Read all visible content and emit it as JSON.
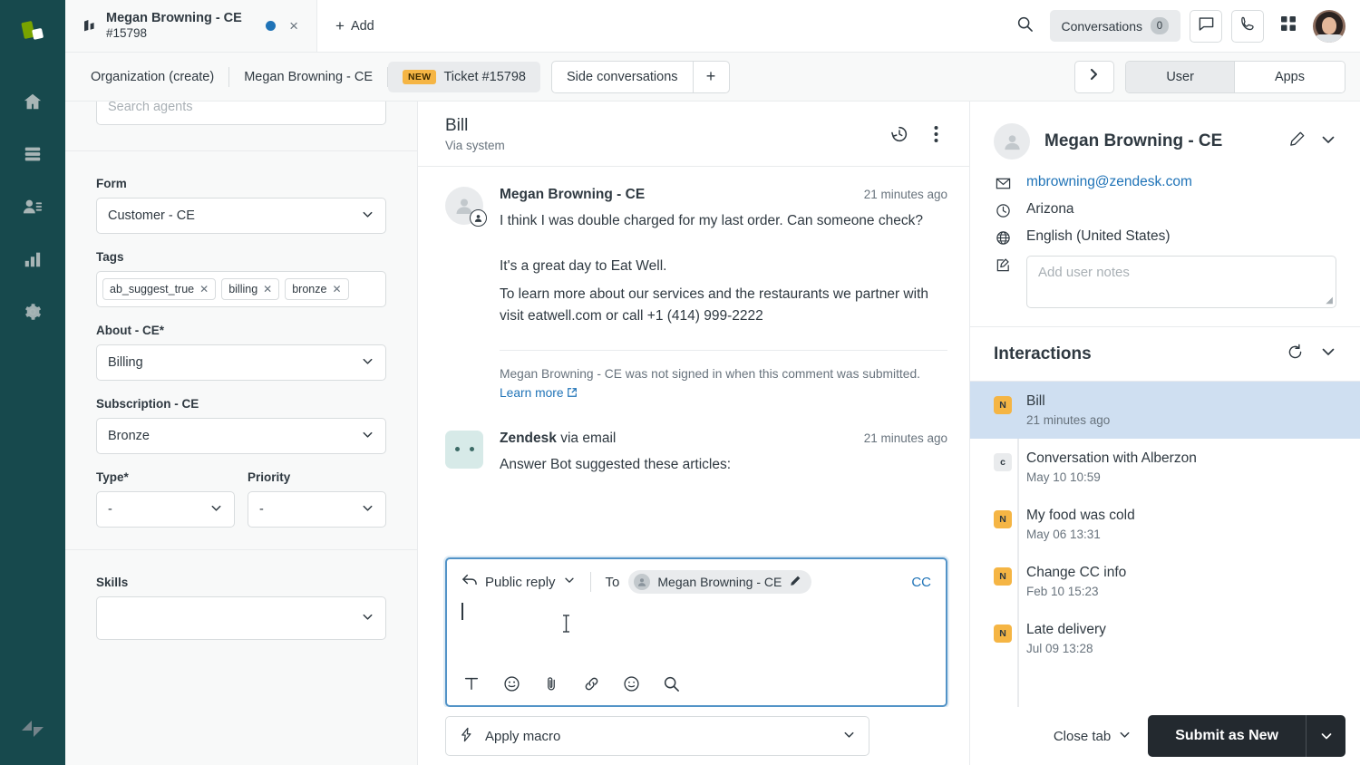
{
  "rail": {
    "logo_icon": "zendesk-mark-icon",
    "items": [
      {
        "icon": "home-icon",
        "name": "home"
      },
      {
        "icon": "views-icon",
        "name": "views"
      },
      {
        "icon": "customers-icon",
        "name": "customers"
      },
      {
        "icon": "reporting-icon",
        "name": "reporting"
      },
      {
        "icon": "settings-gear-icon",
        "name": "settings"
      }
    ],
    "bottom_icon": "zendesk-logo-icon"
  },
  "topbar": {
    "ticket_tab": {
      "title": "Megan Browning - CE",
      "subtitle": "#15798",
      "status_dot_color": "#1f73b7",
      "close_glyph": "×"
    },
    "add_label": "Add",
    "add_glyph": "+",
    "search_icon": "search-icon",
    "conversations_label": "Conversations",
    "conversations_count": "0",
    "chat_icon": "chat-bubble-icon",
    "call_icon": "phone-icon",
    "apps_grid_icon": "apps-grid-icon",
    "avatar_icon": "agent-avatar"
  },
  "crumbs": {
    "items": [
      {
        "label": "Organization (create)",
        "selected": false,
        "badge": ""
      },
      {
        "label": "Megan Browning - CE",
        "selected": false,
        "badge": ""
      },
      {
        "label": "Ticket #15798",
        "selected": true,
        "badge": "NEW"
      }
    ],
    "side_conversations_label": "Side conversations",
    "side_conversations_plus": "+",
    "expand_chevron": "❯",
    "segments": [
      {
        "label": "User",
        "active": true
      },
      {
        "label": "Apps",
        "active": false
      }
    ]
  },
  "form_panel": {
    "search_agents_placeholder": "Search agents",
    "form_label": "Form",
    "form_value": "Customer - CE",
    "tags_label": "Tags",
    "tags": [
      "ab_suggest_true",
      "billing",
      "bronze"
    ],
    "about_label": "About - CE*",
    "about_value": "Billing",
    "subscription_label": "Subscription - CE",
    "subscription_value": "Bronze",
    "type_label": "Type*",
    "type_value": "-",
    "priority_label": "Priority",
    "priority_value": "-",
    "skills_label": "Skills",
    "skills_value": ""
  },
  "conversation": {
    "header_title": "Bill",
    "header_subtitle": "Via system",
    "history_icon": "history-clock-icon",
    "more_icon": "more-vertical-icon",
    "messages": [
      {
        "author": "Megan Browning - CE",
        "author_suffix": "",
        "time": "21 minutes ago",
        "paragraphs": [
          "I think I was double charged for my last order. Can someone check?",
          "It's a great day to Eat Well.",
          "To learn more about our services and the restaurants we partner with visit eatwell.com or call +1 (414) 999-2222"
        ],
        "note_text": "Megan Browning - CE was not signed in when this comment was submitted.",
        "note_link": "Learn more",
        "note_link_icon": "external-link-icon"
      },
      {
        "author": "Zendesk",
        "author_suffix": " via email",
        "time": "21 minutes ago",
        "paragraphs": [
          "Answer Bot suggested these articles:"
        ],
        "note_text": "",
        "note_link": "",
        "note_link_icon": ""
      }
    ]
  },
  "composer": {
    "reply_type": "Public reply",
    "reply_icon": "reply-arrow-icon",
    "reply_chevron": "chevron-down-icon",
    "to_label": "To",
    "to_recipient": "Megan Browning - CE",
    "edit_icon": "pencil-icon",
    "cc_label": "CC",
    "value": "",
    "tools": [
      {
        "icon": "text-format-icon",
        "name": "text-format"
      },
      {
        "icon": "emoji-icon",
        "name": "emoji"
      },
      {
        "icon": "attachment-clip-icon",
        "name": "attachment"
      },
      {
        "icon": "link-icon",
        "name": "link"
      },
      {
        "icon": "mood-icon",
        "name": "mood"
      },
      {
        "icon": "search-knowledge-icon",
        "name": "search-knowledge"
      }
    ]
  },
  "bottom": {
    "macro_icon": "macro-bolt-icon",
    "macro_placeholder": "Apply macro",
    "macro_chevron": "chevron-down-icon",
    "close_tab_label": "Close tab",
    "close_tab_chevron": "chevron-down-icon",
    "submit_label": "Submit as New",
    "submit_chevron": "chevron-down-icon",
    "submit_bg": "#23292f"
  },
  "user_panel": {
    "name": "Megan Browning - CE",
    "edit_icon": "pencil-icon",
    "collapse_icon": "chevron-down-icon",
    "email": "mbrowning@zendesk.com",
    "email_icon": "envelope-icon",
    "timezone": "Arizona",
    "timezone_icon": "clock-icon",
    "language": "English (United States)",
    "language_icon": "globe-icon",
    "notes_icon": "notes-icon",
    "notes_placeholder": "Add user notes",
    "notes_value": ""
  },
  "interactions": {
    "title": "Interactions",
    "refresh_icon": "refresh-icon",
    "collapse_icon": "chevron-down-icon",
    "items": [
      {
        "badge": "N",
        "badge_type": "n",
        "title": "Bill",
        "date": "21 minutes ago",
        "selected": true
      },
      {
        "badge": "c",
        "badge_type": "c",
        "title": "Conversation with Alberzon",
        "date": "May 10 10:59",
        "selected": false
      },
      {
        "badge": "N",
        "badge_type": "n",
        "title": "My food was cold",
        "date": "May 06 13:31",
        "selected": false
      },
      {
        "badge": "N",
        "badge_type": "n",
        "title": "Change CC info",
        "date": "Feb 10 15:23",
        "selected": false
      },
      {
        "badge": "N",
        "badge_type": "n",
        "title": "Late delivery",
        "date": "Jul 09 13:28",
        "selected": false
      }
    ]
  },
  "colors": {
    "rail_bg": "#17494d",
    "accent_blue": "#1f73b7",
    "badge_amber": "#f5b544",
    "selected_row": "#cfdff1",
    "composer_border": "#5293c7"
  }
}
